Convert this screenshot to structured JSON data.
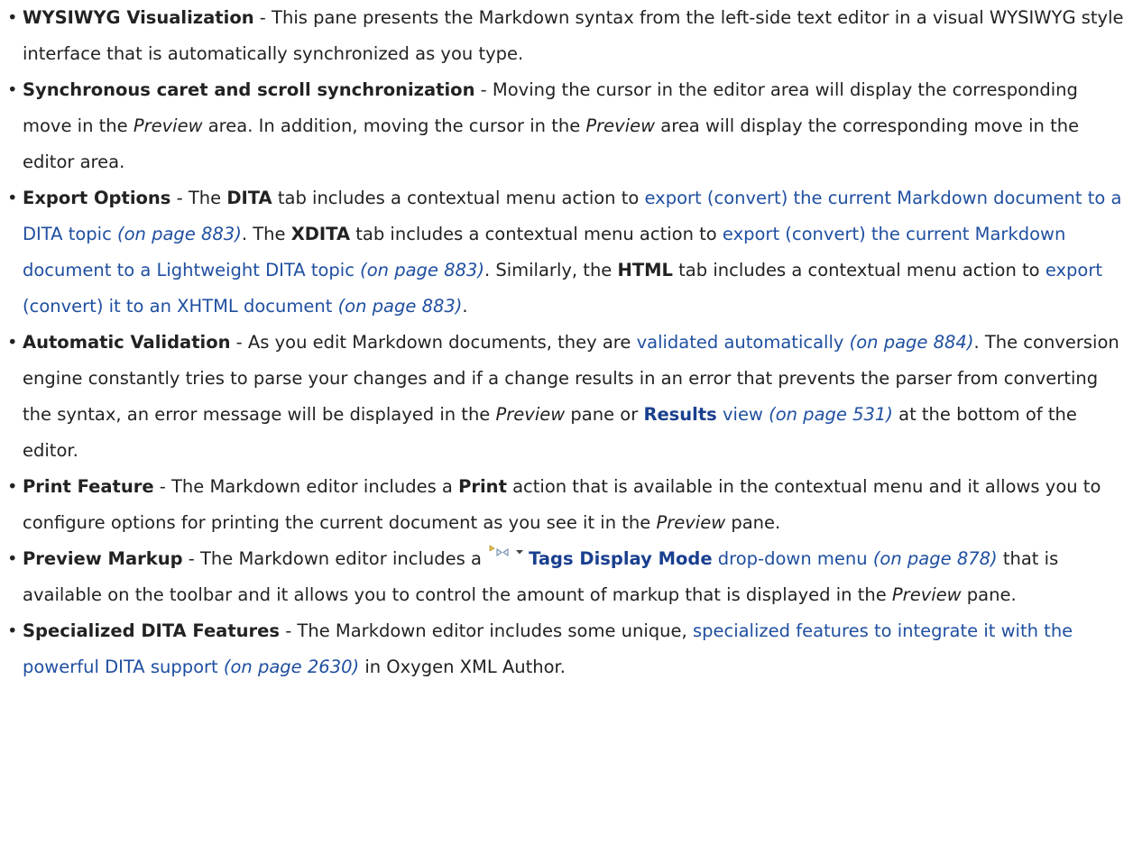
{
  "colors": {
    "text": "#222222",
    "link": "#1f4fa0"
  },
  "items": [
    {
      "title": "WYSIWYG Visualization",
      "t1": " - This pane presents the Markdown syntax from the left-side text editor in a visual WYSIWYG style interface that is automatically synchronized as you type."
    },
    {
      "title": "Synchronous caret and scroll synchronization",
      "t1": " - Moving the cursor in the editor area will display the corresponding move in the ",
      "em1": "Preview",
      "t2": " area. In addition, moving the cursor in the ",
      "em2": "Preview",
      "t3": " area will display the corresponding move in the editor area."
    },
    {
      "title": "Export Options",
      "t1": " - The ",
      "b1": "DITA",
      "t2": " tab includes a contextual menu action to ",
      "link1": "export (convert) the current Markdown document to a DITA topic",
      "ref1": " (on page 883)",
      "t3": ". The ",
      "b2": "XDITA",
      "t4": " tab includes a contextual menu action to ",
      "link2": "export (convert) the current Markdown document to a Lightweight DITA topic",
      "ref2": " (on page 883)",
      "t5": ". Similarly, the ",
      "b3": "HTML",
      "t6": " tab includes a contextual menu action to ",
      "link3": "export (convert) it to an XHTML document",
      "ref3": " (on page 883)",
      "t7": "."
    },
    {
      "title": "Automatic Validation",
      "t1": " - As you edit Markdown documents, they are ",
      "link1": "validated automatically",
      "ref1": " (on page 884)",
      "t2": ". The conversion engine constantly tries to parse your changes and if a change results in an error that prevents the parser from converting the syntax, an error message will be displayed in the ",
      "em1": "Preview",
      "t3": " pane or ",
      "link2b": "Results",
      "link2": " view",
      "ref2": " (on page 531)",
      "t4": " at the bottom of the editor."
    },
    {
      "title": "Print Feature",
      "t1": " - The Markdown editor includes a ",
      "b1": "Print",
      "t2": " action that is available in the contextual menu and it allows you to configure options for printing the current document as you see it in the ",
      "em1": "Preview",
      "t3": " pane."
    },
    {
      "title": "Preview Markup",
      "t1": " - The Markdown editor includes a ",
      "icon": "tags-display-mode-icon",
      "link1b": "Tags Display Mode",
      "link1": " drop-down menu",
      "ref1": " (on page 878)",
      "t2": " that is available on the toolbar and it allows you to control the amount of markup that is displayed in the ",
      "em1": "Preview",
      "t3": " pane."
    },
    {
      "title": "Specialized DITA Features",
      "t1": " - The Markdown editor includes some unique, ",
      "link1": "specialized features to integrate it with the powerful DITA support",
      "ref1": " (on page 2630)",
      "t2": " in Oxygen XML Author."
    }
  ]
}
